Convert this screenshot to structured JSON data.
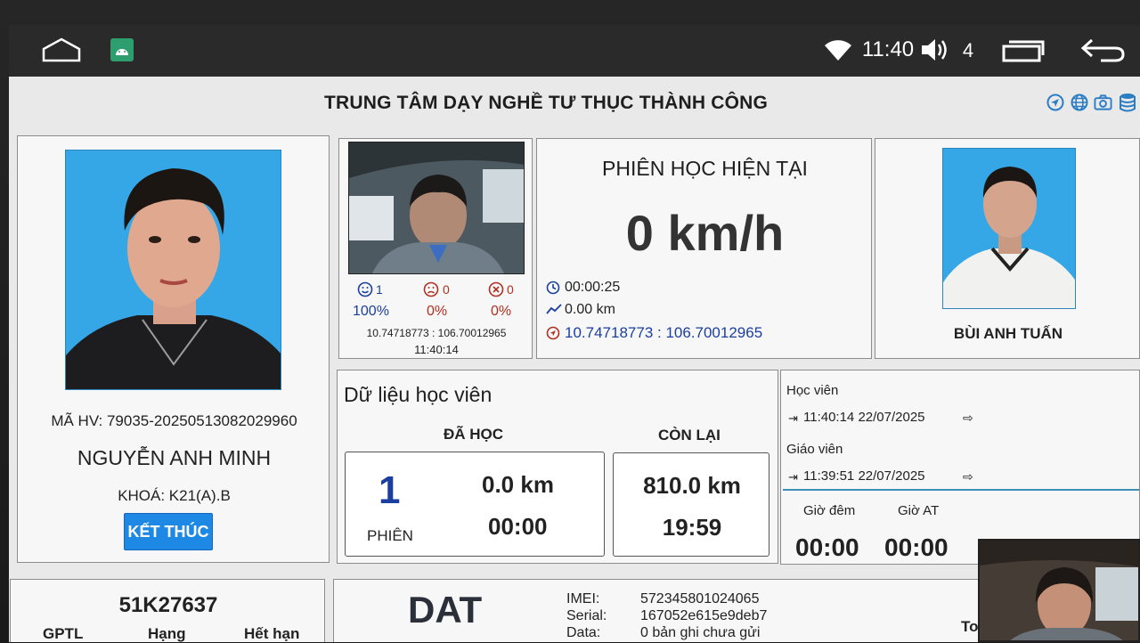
{
  "status_bar": {
    "time": "11:40",
    "volume_level": "4"
  },
  "header": {
    "title": "TRUNG TÂM DẠY NGHỀ TƯ THỤC THÀNH CÔNG"
  },
  "student": {
    "id_label": "MÃ HV: 79035-20250513082029960",
    "name": "NGUYỄN ANH MINH",
    "course": "KHOÁ: K21(A).B",
    "end_button": "KẾT THÚC"
  },
  "camera": {
    "happy_count": "1",
    "sad_count": "0",
    "error_count": "0",
    "happy_pct": "100%",
    "sad_pct": "0%",
    "error_pct": "0%",
    "coords": "10.74718773 : 106.70012965",
    "time": "11:40:14"
  },
  "session": {
    "title": "PHIÊN HỌC HIỆN TẠI",
    "speed": "0 km/h",
    "duration": "00:00:25",
    "distance": "0.00 km",
    "coords": "10.74718773 : 106.70012965"
  },
  "teacher": {
    "name": "BÙI ANH TUẤN"
  },
  "student_data": {
    "title": "Dữ liệu học viên",
    "done_label": "ĐÃ HỌC",
    "remaining_label": "CÒN LẠI",
    "sessions": "1",
    "sessions_label": "PHIÊN",
    "done_km": "0.0 km",
    "done_time": "00:00",
    "remain_km": "810.0 km",
    "remain_time": "19:59"
  },
  "login": {
    "student_label": "Học viên",
    "student_time": "11:40:14 22/07/2025",
    "teacher_label": "Giáo viên",
    "teacher_time": "11:39:51 22/07/2025",
    "night_label": "Giờ đêm",
    "at_label": "Giờ AT",
    "night_value": "00:00",
    "at_value": "00:00"
  },
  "vehicle": {
    "plate": "51K27637",
    "gptl_label": "GPTL",
    "class_label": "Hạng",
    "expiry_label": "Hết hạn"
  },
  "device": {
    "brand": "DAT",
    "imei_label": "IMEI:",
    "imei": "572345801024065",
    "serial_label": "Serial:",
    "serial": "167052e615e9deb7",
    "data_label": "Data:",
    "data": "0 bản ghi chưa gửi",
    "partial_text": "To"
  },
  "colors": {
    "accent_blue": "#1e88e5",
    "photo_bg": "#35a7e6",
    "coord_blue": "#1a3fa0"
  }
}
